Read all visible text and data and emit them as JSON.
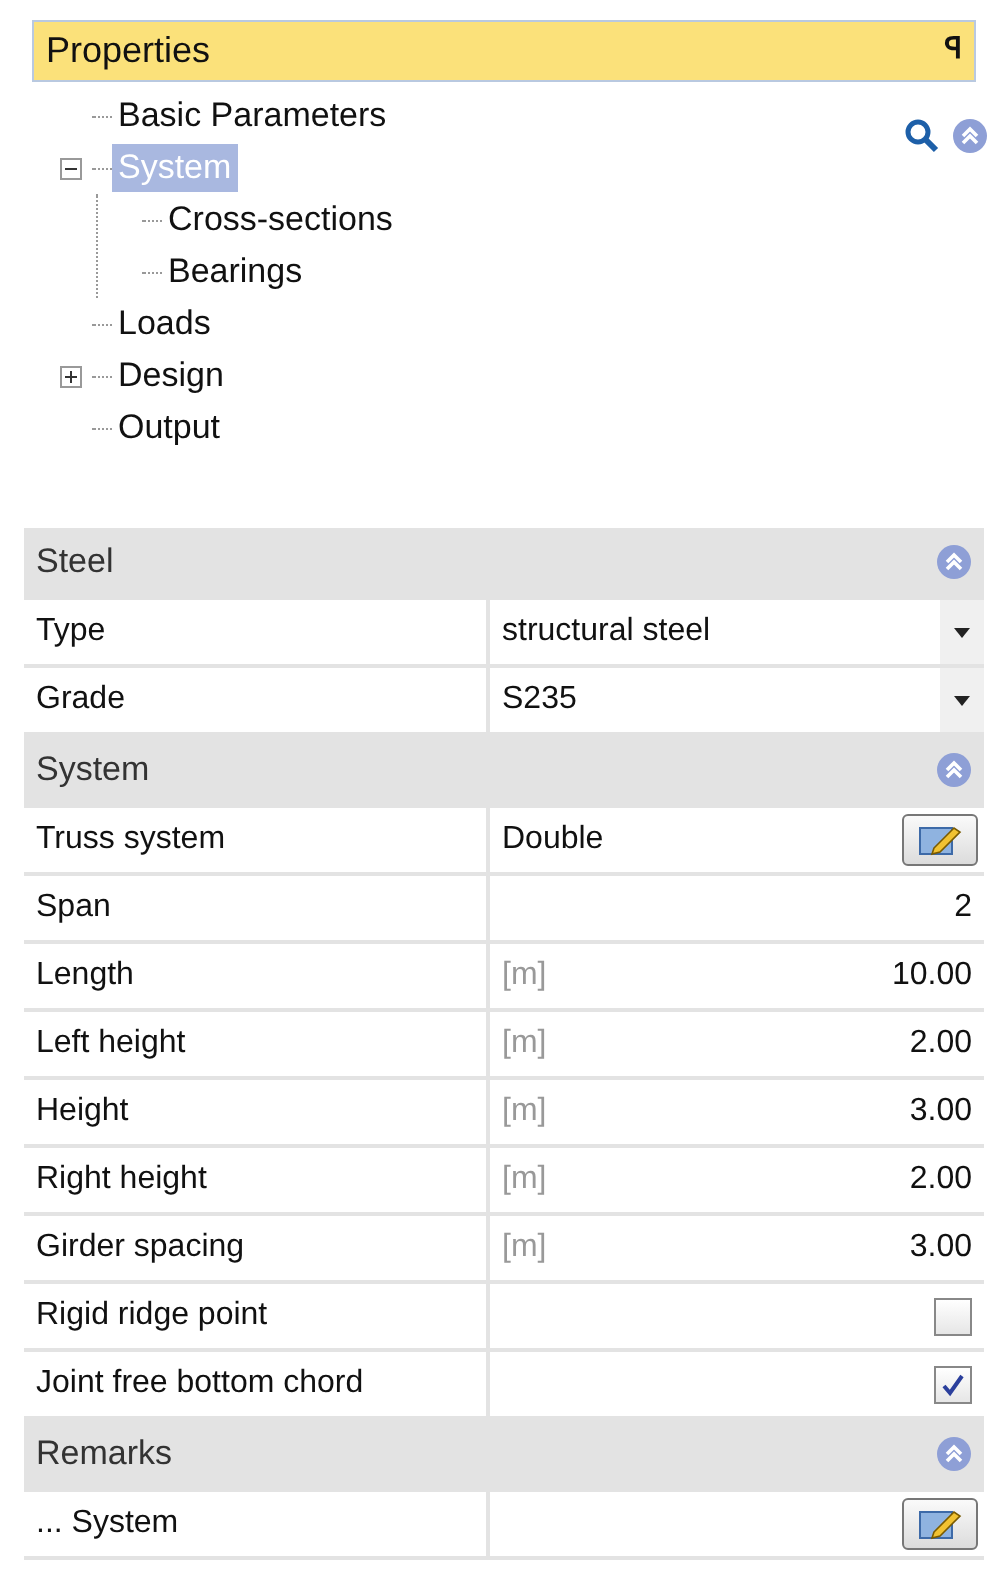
{
  "panel": {
    "title": "Properties",
    "pin": "ꟼ"
  },
  "tree": [
    {
      "label": "Basic Parameters",
      "selected": false
    },
    {
      "label": "System",
      "selected": true,
      "expanded": true,
      "children": [
        {
          "label": "Cross-sections",
          "selected": false
        },
        {
          "label": "Bearings",
          "selected": false
        }
      ]
    },
    {
      "label": "Loads",
      "selected": false
    },
    {
      "label": "Design",
      "selected": false,
      "expanded": false
    },
    {
      "label": "Output",
      "selected": false
    }
  ],
  "sections": [
    {
      "title": "Steel",
      "expanded": true,
      "rows": [
        {
          "kind": "dropdown",
          "label": "Type",
          "value": "structural steel"
        },
        {
          "kind": "dropdown",
          "label": "Grade",
          "value": "S235"
        }
      ]
    },
    {
      "title": "System",
      "expanded": true,
      "rows": [
        {
          "kind": "button",
          "label": "Truss system",
          "value": "Double"
        },
        {
          "kind": "value",
          "label": "Span",
          "value": "2"
        },
        {
          "kind": "value",
          "label": "Length",
          "unit": "[m]",
          "value": "10.00"
        },
        {
          "kind": "value",
          "label": "Left height",
          "unit": "[m]",
          "value": "2.00"
        },
        {
          "kind": "value",
          "label": "Height",
          "unit": "[m]",
          "value": "3.00"
        },
        {
          "kind": "value",
          "label": "Right height",
          "unit": "[m]",
          "value": "2.00"
        },
        {
          "kind": "value",
          "label": "Girder spacing",
          "unit": "[m]",
          "value": "3.00"
        },
        {
          "kind": "checkbox",
          "label": "Rigid ridge point",
          "checked": false
        },
        {
          "kind": "checkbox",
          "label": "Joint free bottom chord",
          "checked": true
        }
      ]
    },
    {
      "title": "Remarks",
      "expanded": true,
      "rows": [
        {
          "kind": "button",
          "label": "... System"
        }
      ]
    }
  ]
}
